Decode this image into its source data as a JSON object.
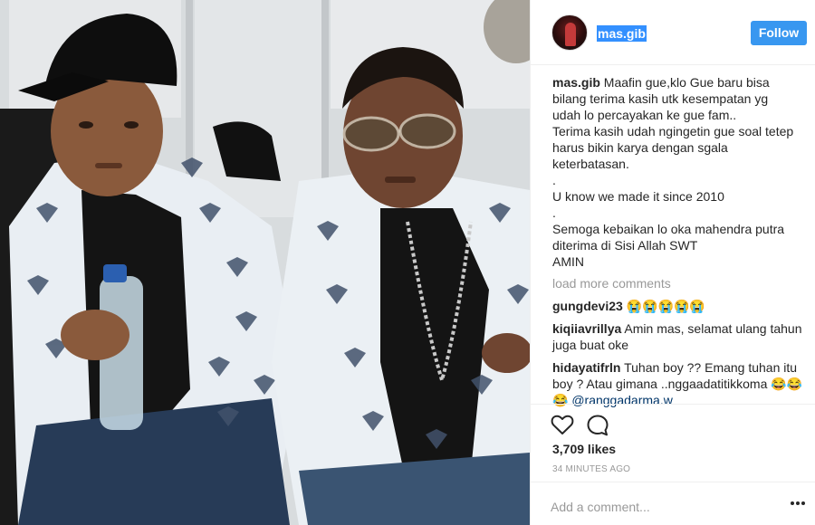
{
  "post": {
    "username": "mas.gib",
    "follow_label": "Follow",
    "caption_lines": [
      "Maafin gue,klo Gue baru bisa",
      "bilang terima kasih utk kesempatan yg",
      "udah lo percayakan ke gue fam..",
      "Terima kasih udah ngingetin gue soal tetep",
      "harus bikin karya dengan sgala",
      "keterbatasan.",
      ".",
      "U know we made it since 2010",
      ".",
      "Semoga kebaikan lo oka mahendra putra",
      "diterima di Sisi Allah SWT",
      "AMIN"
    ],
    "load_more": "load more comments",
    "comments": [
      {
        "user": "gungdevi23",
        "text": "😭😭😭😭😭",
        "mention": ""
      },
      {
        "user": "kiqiiavrillya",
        "text": "Amin mas, selamat ulang tahun juga buat oke",
        "mention": ""
      },
      {
        "user": "hidayatifrln",
        "text": "Tuhan boy ?? Emang tuhan itu boy ? Atau gimana ..nggaadatitikkoma 😂😂😂",
        "mention": "@ranggadarma.w"
      }
    ],
    "likes": "3,709 likes",
    "timestamp": "34 MINUTES AGO",
    "add_comment_placeholder": "Add a comment..."
  },
  "icons": {
    "like": "heart-icon",
    "comment": "comment-bubble-icon",
    "options": "more-options-icon"
  },
  "colors": {
    "follow_button": "#3897f0",
    "muted_text": "#999999",
    "mention": "#003569"
  }
}
